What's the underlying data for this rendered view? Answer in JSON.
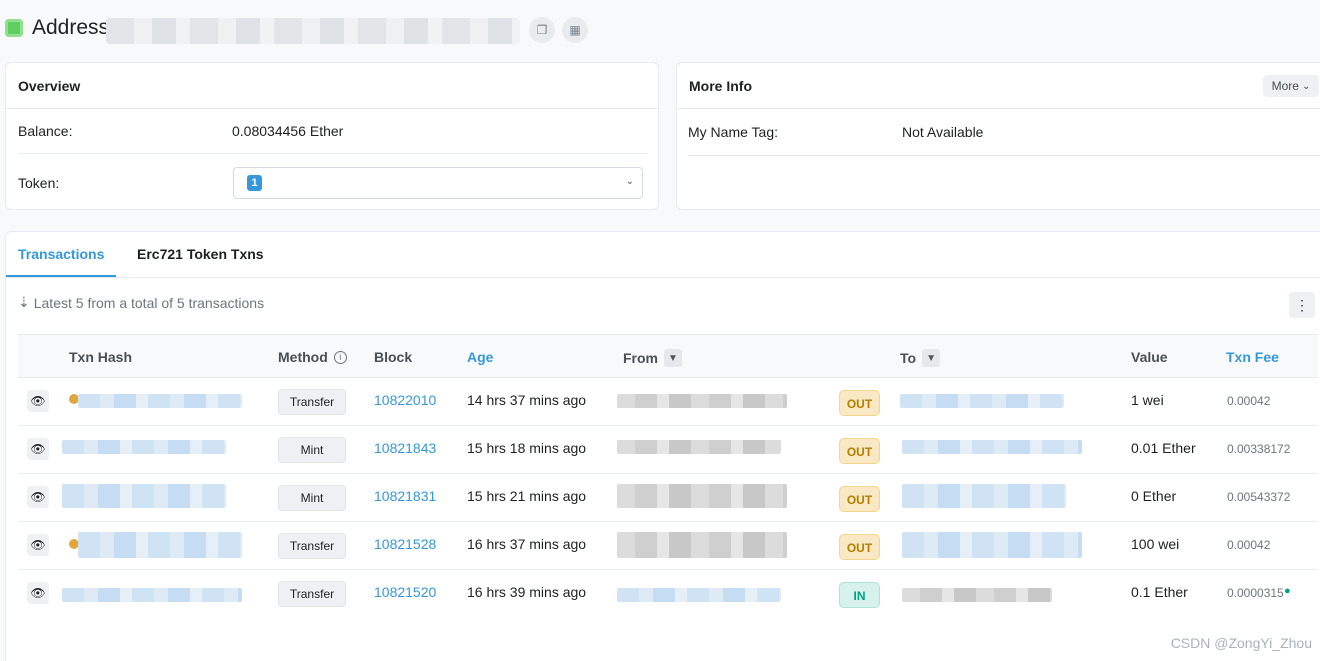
{
  "header": {
    "title": "Address",
    "copy_icon": "copy-icon",
    "qr_icon": "qr-code-icon"
  },
  "overview": {
    "title": "Overview",
    "balance_label": "Balance:",
    "balance_value": "0.08034456 Ether",
    "token_label": "Token:",
    "token_count": "1"
  },
  "more_info": {
    "title": "More Info",
    "more_button": "More",
    "name_tag_label": "My Name Tag:",
    "name_tag_value": "Not Available"
  },
  "tabs": [
    {
      "label": "Transactions"
    },
    {
      "label": "Erc721 Token Txns"
    }
  ],
  "summary": "Latest 5 from a total of 5 transactions",
  "table": {
    "headers": {
      "txn_hash": "Txn Hash",
      "method": "Method",
      "block": "Block",
      "age": "Age",
      "from": "From",
      "to": "To",
      "value": "Value",
      "txn_fee": "Txn Fee"
    },
    "rows": [
      {
        "method": "Transfer",
        "block": "10822010",
        "age": "14 hrs 37 mins ago",
        "direction": "OUT",
        "value": "1 wei",
        "fee": "0.00042"
      },
      {
        "method": "Mint",
        "block": "10821843",
        "age": "15 hrs 18 mins ago",
        "direction": "OUT",
        "value": "0.01 Ether",
        "fee": "0.00338172"
      },
      {
        "method": "Mint",
        "block": "10821831",
        "age": "15 hrs 21 mins ago",
        "direction": "OUT",
        "value": "0 Ether",
        "fee": "0.00543372"
      },
      {
        "method": "Transfer",
        "block": "10821528",
        "age": "16 hrs 37 mins ago",
        "direction": "OUT",
        "value": "100 wei",
        "fee": "0.00042"
      },
      {
        "method": "Transfer",
        "block": "10821520",
        "age": "16 hrs 39 mins ago",
        "direction": "IN",
        "value": "0.1 Ether",
        "fee": "0.0000315"
      }
    ]
  },
  "watermark": "CSDN @ZongYi_Zhou"
}
